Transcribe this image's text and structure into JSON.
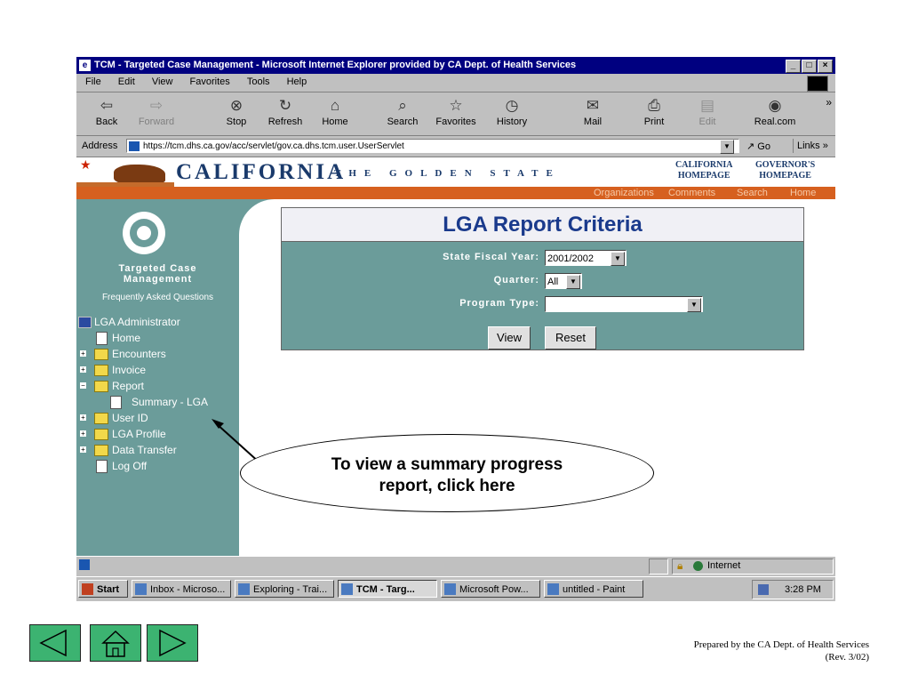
{
  "window": {
    "title": "TCM - Targeted Case Management - Microsoft Internet Explorer provided by CA Dept. of Health Services",
    "controls": [
      "_",
      "□",
      "×"
    ]
  },
  "menu": [
    "File",
    "Edit",
    "View",
    "Favorites",
    "Tools",
    "Help"
  ],
  "toolbar": [
    {
      "label": "Back",
      "icon": "back-arrow-icon",
      "glyph": "⇦"
    },
    {
      "label": "Forward",
      "icon": "forward-arrow-icon",
      "glyph": "⇨"
    },
    {
      "label": "Stop",
      "icon": "stop-icon",
      "glyph": "⊗"
    },
    {
      "label": "Refresh",
      "icon": "refresh-icon",
      "glyph": "↻"
    },
    {
      "label": "Home",
      "icon": "home-icon",
      "glyph": "⌂"
    },
    {
      "label": "Search",
      "icon": "search-icon",
      "glyph": "⌕"
    },
    {
      "label": "Favorites",
      "icon": "favorites-icon",
      "glyph": "☆"
    },
    {
      "label": "History",
      "icon": "history-icon",
      "glyph": "◷"
    },
    {
      "label": "Mail",
      "icon": "mail-icon",
      "glyph": "✉"
    },
    {
      "label": "Print",
      "icon": "print-icon",
      "glyph": "⎙"
    },
    {
      "label": "Edit",
      "icon": "edit-icon",
      "glyph": "▤"
    },
    {
      "label": "Real.com",
      "icon": "realcom-icon",
      "glyph": "◉"
    }
  ],
  "toolbar_more": "»",
  "address": {
    "label": "Address",
    "url": "https://tcm.dhs.ca.gov/acc/servlet/gov.ca.dhs.tcm.user.UserServlet",
    "go": "Go",
    "links": "Links »"
  },
  "banner": {
    "california": "CALIFORNIA",
    "tagline": "THE GOLDEN STATE",
    "ca_homepage": [
      "CALIFORNIA",
      "HOMEPAGE"
    ],
    "gov_homepage": [
      "GOVERNOR'S",
      "HOMEPAGE"
    ],
    "nav_links": [
      "Organizations",
      "Comments",
      "Search",
      "Home"
    ]
  },
  "sidebar": {
    "app_name": [
      "Targeted Case",
      "Management"
    ],
    "faq": "Frequently Asked Questions",
    "user": "LGA Administrator",
    "items": [
      {
        "label": "Home",
        "kind": "doc",
        "level": 1
      },
      {
        "label": "Encounters",
        "kind": "folder",
        "toggle": "+",
        "level": 1
      },
      {
        "label": "Invoice",
        "kind": "folder",
        "toggle": "+",
        "level": 1
      },
      {
        "label": "Report",
        "kind": "folder-open",
        "toggle": "−",
        "level": 1
      },
      {
        "label": "Summary - LGA",
        "kind": "doc",
        "level": 2
      },
      {
        "label": "User ID",
        "kind": "folder",
        "toggle": "+",
        "level": 1
      },
      {
        "label": "LGA Profile",
        "kind": "folder",
        "toggle": "+",
        "level": 1
      },
      {
        "label": "Data Transfer",
        "kind": "folder",
        "toggle": "+",
        "level": 1
      },
      {
        "label": "Log Off",
        "kind": "doc",
        "level": 1
      }
    ]
  },
  "form": {
    "title": "LGA Report Criteria",
    "fiscal_year_label": "State Fiscal Year:",
    "fiscal_year_value": "2001/2002",
    "quarter_label": "Quarter:",
    "quarter_value": "All",
    "program_type_label": "Program Type:",
    "program_type_value": "",
    "view_button": "View",
    "reset_button": "Reset"
  },
  "callout": [
    "To view a summary progress",
    "report, click here"
  ],
  "status": {
    "zone": "Internet"
  },
  "taskbar": {
    "start": "Start",
    "tasks": [
      {
        "label": "Inbox - Microso...",
        "active": false
      },
      {
        "label": "Exploring - Trai...",
        "active": false
      },
      {
        "label": "TCM - Targ...",
        "active": true
      },
      {
        "label": "Microsoft Pow...",
        "active": false
      },
      {
        "label": "untitled - Paint",
        "active": false
      }
    ],
    "clock": "3:28 PM"
  },
  "slide_nav": [
    {
      "name": "previous-slide-button",
      "icon": "left-triangle-icon"
    },
    {
      "name": "home-slide-button",
      "icon": "house-icon"
    },
    {
      "name": "next-slide-button",
      "icon": "right-triangle-icon"
    }
  ],
  "footer": [
    "Prepared by the CA Dept. of Health Services",
    "(Rev. 3/02)"
  ],
  "colors": {
    "teal": "#6b9c9a",
    "title_blue": "#000080",
    "nav_orange": "#d6601f",
    "slide_green": "#3cb371"
  }
}
